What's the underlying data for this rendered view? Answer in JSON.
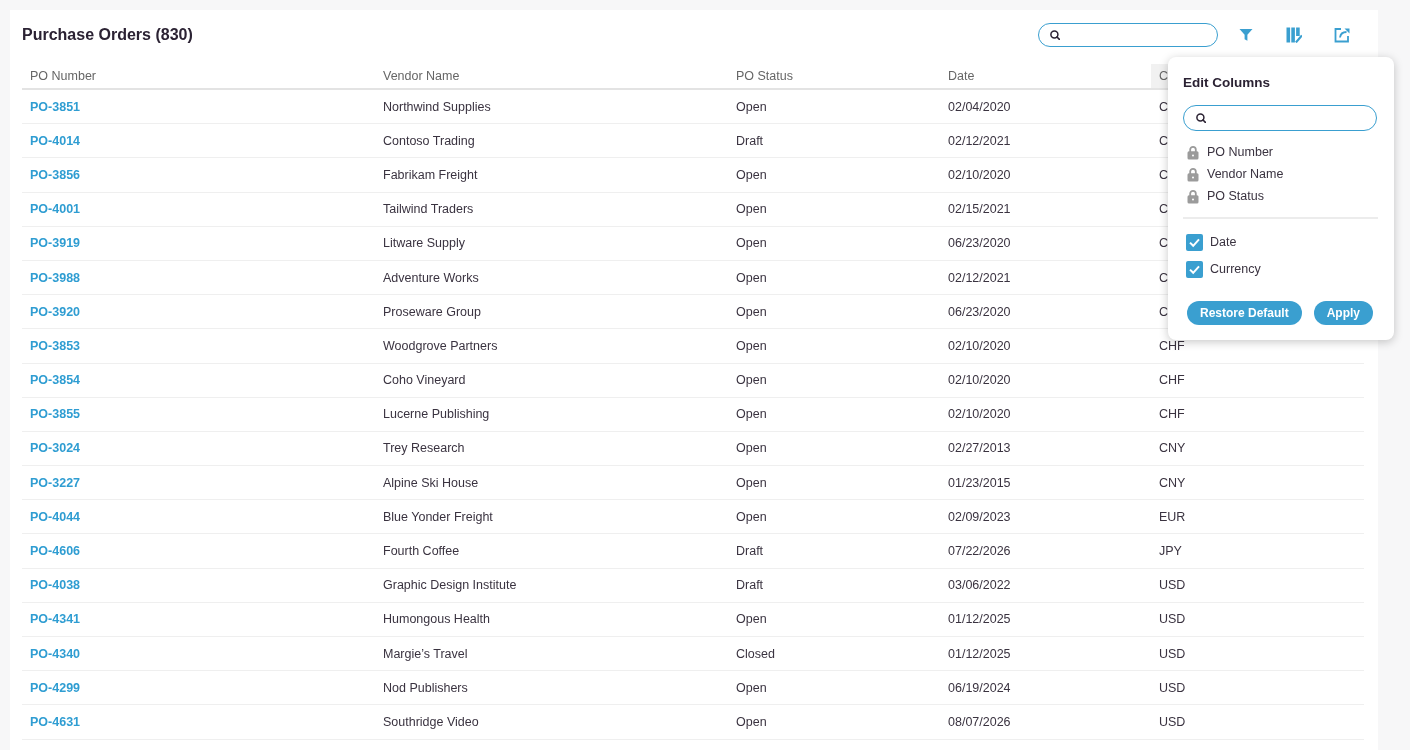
{
  "header": {
    "title": "Purchase Orders (830)"
  },
  "table": {
    "columns": [
      {
        "label": "PO Number",
        "highlighted": false
      },
      {
        "label": "Vendor Name",
        "highlighted": false
      },
      {
        "label": "PO Status",
        "highlighted": false
      },
      {
        "label": "Date",
        "highlighted": false
      },
      {
        "label": "C",
        "highlighted": true
      }
    ],
    "rows": [
      {
        "po_number": "PO-3851",
        "vendor_name": "Northwind Supplies",
        "po_status": "Open",
        "date": "02/04/2020",
        "column_5": "C"
      },
      {
        "po_number": "PO-4014",
        "vendor_name": "Contoso Trading",
        "po_status": "Draft",
        "date": "02/12/2021",
        "column_5": "C"
      },
      {
        "po_number": "PO-3856",
        "vendor_name": "Fabrikam Freight",
        "po_status": "Open",
        "date": "02/10/2020",
        "column_5": "C"
      },
      {
        "po_number": "PO-4001",
        "vendor_name": "Tailwind Traders",
        "po_status": "Open",
        "date": "02/15/2021",
        "column_5": "C"
      },
      {
        "po_number": "PO-3919",
        "vendor_name": "Litware Supply",
        "po_status": "Open",
        "date": "06/23/2020",
        "column_5": "C"
      },
      {
        "po_number": "PO-3988",
        "vendor_name": "Adventure Works",
        "po_status": "Open",
        "date": "02/12/2021",
        "column_5": "C"
      },
      {
        "po_number": "PO-3920",
        "vendor_name": "Proseware Group",
        "po_status": "Open",
        "date": "06/23/2020",
        "column_5": "C"
      },
      {
        "po_number": "PO-3853",
        "vendor_name": "Woodgrove Partners",
        "po_status": "Open",
        "date": "02/10/2020",
        "column_5": "CHF"
      },
      {
        "po_number": "PO-3854",
        "vendor_name": "Coho Vineyard",
        "po_status": "Open",
        "date": "02/10/2020",
        "column_5": "CHF"
      },
      {
        "po_number": "PO-3855",
        "vendor_name": "Lucerne Publishing",
        "po_status": "Open",
        "date": "02/10/2020",
        "column_5": "CHF"
      },
      {
        "po_number": "PO-3024",
        "vendor_name": "Trey Research",
        "po_status": "Open",
        "date": "02/27/2013",
        "column_5": "CNY"
      },
      {
        "po_number": "PO-3227",
        "vendor_name": "Alpine Ski House",
        "po_status": "Open",
        "date": "01/23/2015",
        "column_5": "CNY"
      },
      {
        "po_number": "PO-4044",
        "vendor_name": "Blue Yonder Freight",
        "po_status": "Open",
        "date": "02/09/2023",
        "column_5": "EUR"
      },
      {
        "po_number": "PO-4606",
        "vendor_name": "Fourth Coffee",
        "po_status": "Draft",
        "date": "07/22/2026",
        "column_5": "JPY"
      },
      {
        "po_number": "PO-4038",
        "vendor_name": "Graphic Design Institute",
        "po_status": "Draft",
        "date": "03/06/2022",
        "column_5": "USD"
      },
      {
        "po_number": "PO-4341",
        "vendor_name": "Humongous Health",
        "po_status": "Open",
        "date": "01/12/2025",
        "column_5": "USD"
      },
      {
        "po_number": "PO-4340",
        "vendor_name": "Margie’s Travel",
        "po_status": "Closed",
        "date": "01/12/2025",
        "column_5": "USD"
      },
      {
        "po_number": "PO-4299",
        "vendor_name": "Nod Publishers",
        "po_status": "Open",
        "date": "06/19/2024",
        "column_5": "USD"
      },
      {
        "po_number": "PO-4631",
        "vendor_name": "Southridge Video",
        "po_status": "Open",
        "date": "08/07/2026",
        "column_5": "USD"
      }
    ]
  },
  "edit_columns": {
    "title": "Edit Columns",
    "locked_columns": [
      {
        "label": "PO Number"
      },
      {
        "label": "Vendor Name"
      },
      {
        "label": "PO Status"
      }
    ],
    "optional_columns": [
      {
        "label": "Date",
        "checked": true
      },
      {
        "label": "Currency",
        "checked": true
      }
    ],
    "buttons": [
      {
        "label": "Restore Default"
      },
      {
        "label": "Apply"
      }
    ]
  }
}
